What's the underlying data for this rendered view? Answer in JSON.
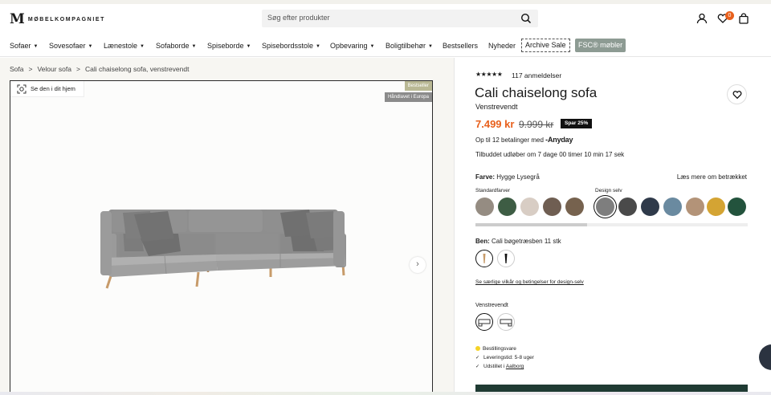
{
  "header": {
    "logo_mark": "M",
    "logo_text": "MØBELKOMPAGNIET",
    "search_placeholder": "Søg efter produkter",
    "cart_count": "0"
  },
  "nav": {
    "items": [
      {
        "label": "Sofaer"
      },
      {
        "label": "Sovesofaer"
      },
      {
        "label": "Lænestole"
      },
      {
        "label": "Sofaborde"
      },
      {
        "label": "Spiseborde"
      },
      {
        "label": "Spisebordsstole"
      },
      {
        "label": "Opbevaring"
      },
      {
        "label": "Boligtilbehør"
      },
      {
        "label": "Bestsellers"
      },
      {
        "label": "Nyheder"
      },
      {
        "label": "Archive Sale"
      },
      {
        "label": "FSC® møbler"
      }
    ]
  },
  "breadcrumb": [
    "Sofa",
    "Velour sofa",
    "Cali chaiselong sofa, venstrevendt"
  ],
  "gallery": {
    "see_at_home": "Se den i dit hjem",
    "tag_bestseller": "Bestseller",
    "tag_handmade": "Håndlavet i Europa"
  },
  "product": {
    "rating": 5,
    "reviews": "117 anmeldelser",
    "title": "Cali chaiselong sofa",
    "subtitle": "Venstrevendt",
    "price": "7.499 kr",
    "old_price": "9.999 kr",
    "save_badge": "Spar 25%",
    "installments": "Op til 12 betalinger med",
    "anyday_brand": "Anyday",
    "offer": "Tilbuddet udløber om 7 dage 00 timer 10 min 17 sek",
    "color_label": "Farve:",
    "color_value": "Hygge Lysegrå",
    "learn_more": "Læs mere om betrækket",
    "standard_colors_label": "Standardfarver",
    "design_label": "Design selv",
    "standard_colors": [
      "#958c82",
      "#3e5d44",
      "#d8cdc4",
      "#6f5e52",
      "#76624e"
    ],
    "design_colors": [
      "#7e7e7e",
      "#4a4a4a",
      "#2f3a4a",
      "#6a8aa0",
      "#b39378",
      "#d4a433",
      "#23533d"
    ],
    "legs_label": "Ben:",
    "legs_value": "Cali bøgetræsben 11 stk",
    "terms_link": "Se særlige vilkår og betingelser for design-selv",
    "variant_label": "Venstrevendt",
    "stock_status": "Bestillingsvare",
    "delivery": "Leveringstid: 5-8 uger",
    "showroom_prefix": "Udstillet i",
    "showroom_city": "Aalborg"
  },
  "colors": {
    "accent": "#e8601c",
    "cta": "#1f3b33"
  }
}
